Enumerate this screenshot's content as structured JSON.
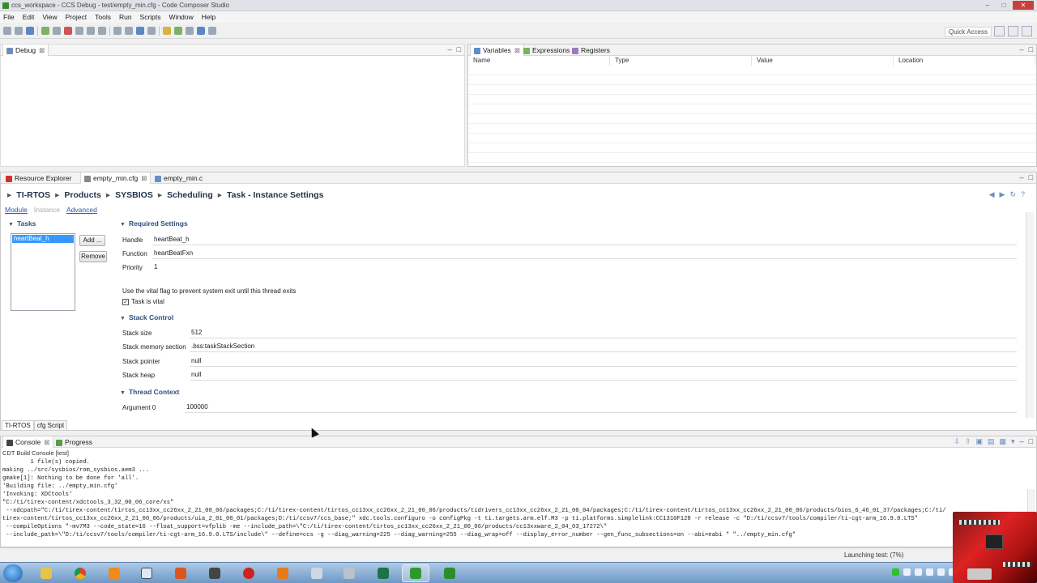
{
  "window": {
    "title": "ccs_workspace - CCS Debug - test/empty_min.cfg - Code Composer Studio",
    "minimize": "–",
    "maximize": "□",
    "close": "✕"
  },
  "menu": [
    "File",
    "Edit",
    "View",
    "Project",
    "Tools",
    "Run",
    "Scripts",
    "Window",
    "Help"
  ],
  "toolbar": {
    "quick_access": "Quick Access"
  },
  "debug_view": {
    "tab": "Debug",
    "close": "⊠"
  },
  "variables_view": {
    "tabs": [
      "Variables",
      "Expressions",
      "Registers"
    ],
    "columns": [
      "Name",
      "Type",
      "Value",
      "Location"
    ]
  },
  "editor": {
    "tabs": [
      "Resource Explorer",
      "empty_min.cfg",
      "empty_min.c"
    ],
    "breadcrumb": [
      "TI-RTOS",
      "Products",
      "SYSBIOS",
      "Scheduling",
      "Task - Instance Settings"
    ],
    "subtabs": [
      "Module",
      "Instance",
      "Advanced"
    ],
    "tasks_header": "Tasks",
    "task_list": [
      "heartBeat_h"
    ],
    "add_button": "Add ...",
    "remove_button": "Remove",
    "required": {
      "header": "Required Settings",
      "handle_label": "Handle",
      "handle_value": "heartBeat_h",
      "function_label": "Function",
      "function_value": "heartBeatFxn",
      "priority_label": "Priority",
      "priority_value": "1",
      "vital_note": "Use the vital flag to prevent system exit until this thread exits",
      "vital_checkbox": "Task is vital"
    },
    "stack": {
      "header": "Stack Control",
      "size_label": "Stack size",
      "size_value": "512",
      "section_label": "Stack memory section",
      "section_value": ".bss:taskStackSection",
      "pointer_label": "Stack pointer",
      "pointer_value": "null",
      "heap_label": "Stack heap",
      "heap_value": "null"
    },
    "thread": {
      "header": "Thread Context",
      "arg0_label": "Argument 0",
      "arg0_value": "100000"
    },
    "bottom_tabs": [
      "TI-RTOS",
      "cfg Script"
    ]
  },
  "console": {
    "tabs": [
      "Console",
      "Progress"
    ],
    "title": "CDT Build Console [test]",
    "lines": [
      "        1 file(s) copied.",
      "making ../src/sysbios/rom_sysbios.aem3 ...",
      "gmake[1]: Nothing to be done for 'all'.",
      "'Building file: ../empty_min.cfg'",
      "'Invoking: XDCtools'",
      "\"C:/ti/tirex-content/xdctools_3_32_00_06_core/xs\"",
      " --xdcpath=\"C:/ti/tirex-content/tirtos_cc13xx_cc26xx_2_21_00_06/packages;C:/ti/tirex-content/tirtos_cc13xx_cc26xx_2_21_00_06/products/tidrivers_cc13xx_cc26xx_2_21_00_04/packages;C:/ti/tirex-content/tirtos_cc13xx_cc26xx_2_21_00_06/products/bios_6_46_01_37/packages;C:/ti/",
      "tirex-content/tirtos_cc13xx_cc26xx_2_21_00_06/products/uia_2_01_00_01/packages;D:/ti/ccsv7/ccs_base;\" xdc.tools.configuro -o configPkg -t ti.targets.arm.elf.M3 -p ti.platforms.simplelink:CC1310F128 -r release -c \"D:/ti/ccsv7/tools/compiler/ti-cgt-arm_16.9.0.LTS\"",
      " --compileOptions \"-mv7M3 --code_state=16 --float_support=vfplib -me --include_path=\\\"C:/ti/tirex-content/tirtos_cc13xx_cc26xx_2_21_00_06/products/cc13xxware_2_04_03_17272\\\"",
      " --include_path=\\\"D:/ti/ccsv7/tools/compiler/ti-cgt-arm_16.9.0.LTS/include\\\" --define=ccs -g --diag_warning=225 --diag_warning=255 --diag_wrap=off --display_error_number --gen_func_subsections=on --abi=eabi \" \"../empty_min.cfg\""
    ]
  },
  "status": {
    "launching": "Launching test: (7%)"
  }
}
